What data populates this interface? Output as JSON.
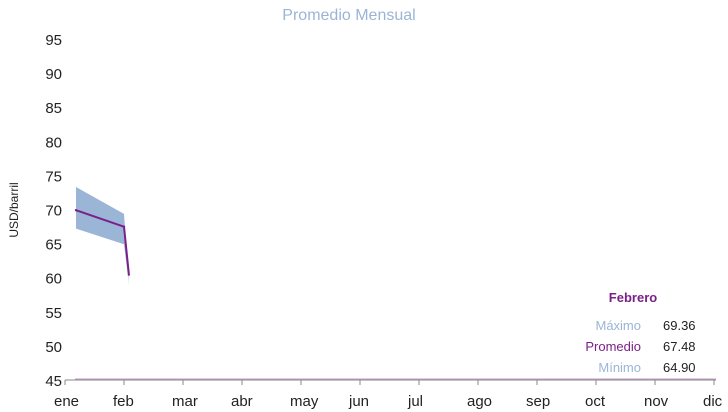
{
  "chart_data": {
    "type": "area",
    "title": "Promedio Mensual",
    "ylabel": "USD/barril",
    "xlabel": "",
    "ylim": [
      45,
      95
    ],
    "yticks": [
      45,
      50,
      55,
      60,
      65,
      70,
      75,
      80,
      85,
      90,
      95
    ],
    "categories": [
      "ene",
      "feb",
      "mar",
      "abr",
      "may",
      "jun",
      "jul",
      "ago",
      "sep",
      "oct",
      "nov",
      "dic"
    ],
    "grid": false,
    "band": {
      "upper": [
        73.3,
        69.36
      ],
      "lower": [
        67.2,
        64.9
      ]
    },
    "series": [
      {
        "name": "Promedio",
        "values": [
          69.9,
          67.48
        ],
        "tail": 60.3
      }
    ],
    "colors": {
      "band": "#9bb5d6",
      "line": "#7b1f8a",
      "title": "#9bb5d6",
      "axis": "#8a8a8a",
      "text": "#222222"
    },
    "annotation": {
      "heading": "Febrero",
      "rows": [
        {
          "label": "Máximo",
          "value": "69.36",
          "color": "#9bb5d6"
        },
        {
          "label": "Promedio",
          "value": "67.48",
          "color": "#7b1f8a"
        },
        {
          "label": "Mínimo",
          "value": "64.90",
          "color": "#9bb5d6"
        }
      ]
    }
  }
}
